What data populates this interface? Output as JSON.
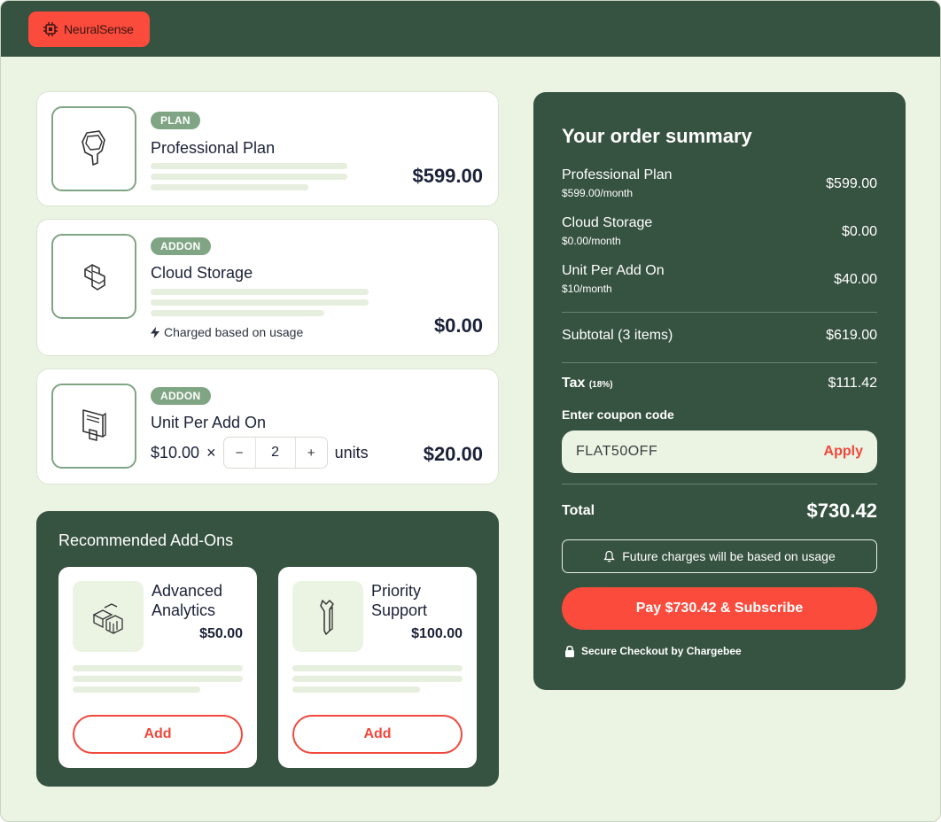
{
  "brand": {
    "name": "NeuralSense"
  },
  "items": [
    {
      "badge": "PLAN",
      "title": "Professional Plan",
      "price": "$599.00",
      "icon": "plan-icon"
    },
    {
      "badge": "ADDON",
      "title": "Cloud Storage",
      "price": "$0.00",
      "note": "Charged based on usage",
      "icon": "storage-icon"
    },
    {
      "badge": "ADDON",
      "title": "Unit Per Add On",
      "unit_price": "$10.00",
      "times": "×",
      "quantity": "2",
      "units_label": "units",
      "minus": "−",
      "plus": "+",
      "price": "$20.00",
      "icon": "unit-icon"
    }
  ],
  "recommended": {
    "title": "Recommended Add-Ons",
    "cards": [
      {
        "name": "Advanced Analytics",
        "price": "$50.00",
        "button": "Add",
        "icon": "analytics-icon"
      },
      {
        "name": "Priority Support",
        "price": "$100.00",
        "button": "Add",
        "icon": "wrench-icon"
      }
    ]
  },
  "summary": {
    "title": "Your order summary",
    "lines": [
      {
        "name": "Professional Plan",
        "sub": "$599.00/month",
        "amount": "$599.00"
      },
      {
        "name": "Cloud Storage",
        "sub": "$0.00/month",
        "amount": "$0.00"
      },
      {
        "name": "Unit Per Add On",
        "sub": "$10/month",
        "amount": "$40.00"
      }
    ],
    "subtotal_label": "Subtotal (3 items)",
    "subtotal": "$619.00",
    "tax_label": "Tax",
    "tax_rate": "(18%)",
    "tax": "$111.42",
    "coupon_label": "Enter coupon code",
    "coupon_code": "FLAT50OFF",
    "apply_label": "Apply",
    "total_label": "Total",
    "total": "$730.42",
    "future_note": "Future charges will be based on usage",
    "pay_label": "Pay $730.42 & Subscribe",
    "secure_note": "Secure Checkout by Chargebee"
  },
  "colors": {
    "accent": "#fb4b3c",
    "dark_green": "#365240",
    "page_bg": "#ebf3e3",
    "badge_green": "#7fa584"
  }
}
